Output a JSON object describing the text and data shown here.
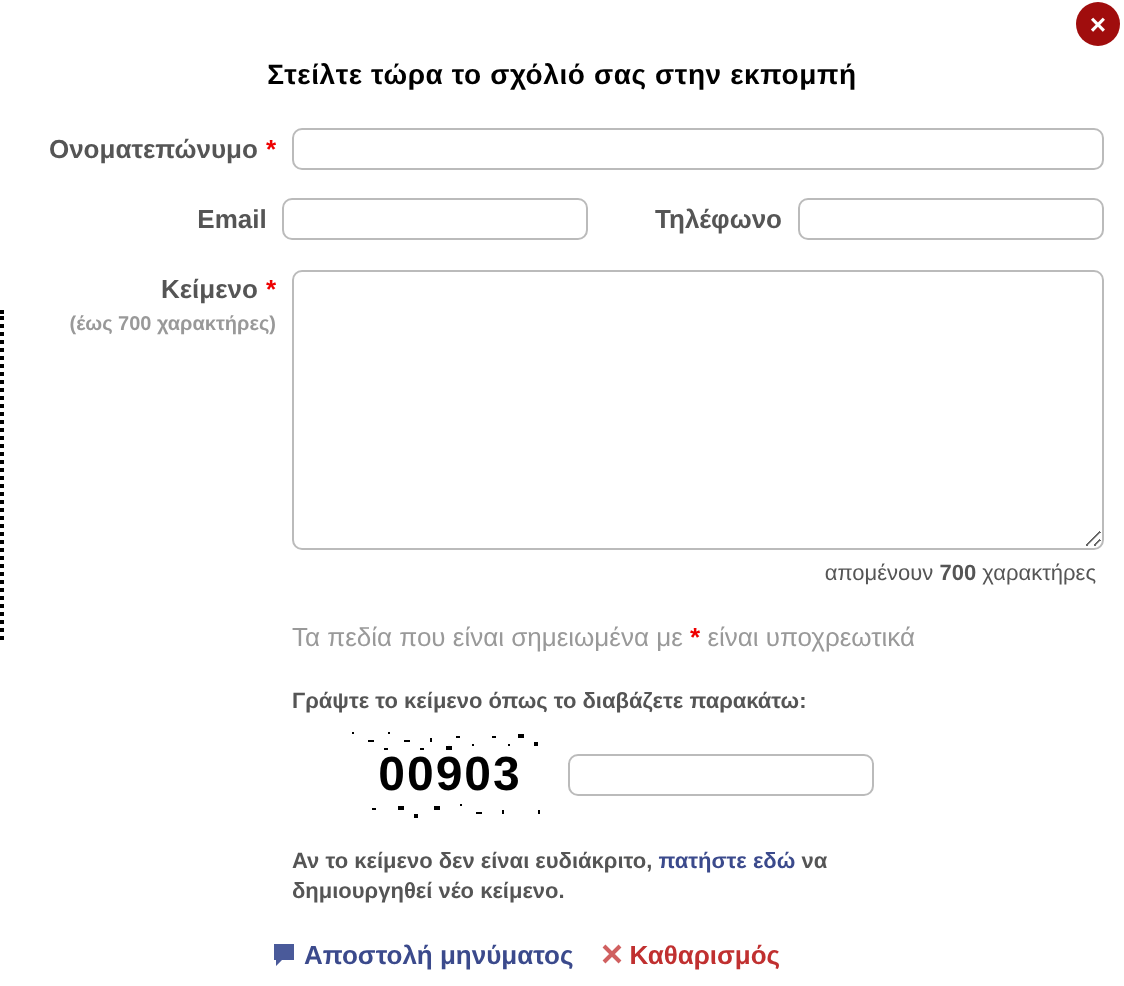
{
  "title": "Στείλτε τώρα το σχόλιό σας στην εκπομπή",
  "close": "×",
  "name_field": {
    "label": "Ονοματεπώνυμο",
    "required": true
  },
  "email_field": {
    "label": "Email",
    "required": false
  },
  "phone_field": {
    "label": "Τηλέφωνο",
    "required": false
  },
  "text_field": {
    "label": "Κείμενο",
    "required": true,
    "hint": "(έως 700 χαρακτήρες)"
  },
  "counter": "απομένουν **700** χαρακτήρες",
  "required_note": {
    "before": "Τα πεδία που είναι σημειωμένα με",
    "mark": "*",
    "after": "είναι υποχρεωτικά"
  },
  "captcha": {
    "label": "Γράψτε το κείμενο όπως το διαβάζετε παρακάτω:",
    "code": "00903"
  },
  "refresh_note": {
    "before": "Αν το κείμενο δεν είναι ευδιάκριτο,",
    "link": "πατήστε εδώ",
    "after": "να δημιουργηθεί νέο κείμενο."
  },
  "buttons": [
    {
      "kind": "send",
      "label": "Αποστολή μηνύματος"
    },
    {
      "kind": "clear",
      "label": "Καθαρισμός"
    }
  ]
}
